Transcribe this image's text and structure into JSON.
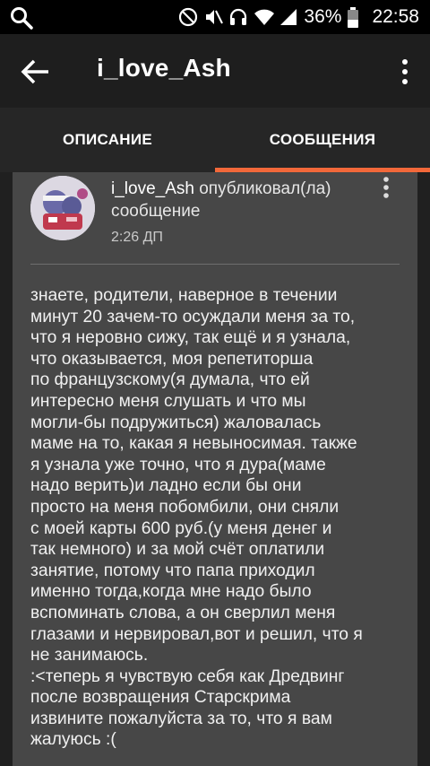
{
  "status_bar": {
    "battery_percent": "36%",
    "time": "22:58"
  },
  "app_bar": {
    "title": "i_love_Ash"
  },
  "tabs": [
    {
      "label": "ОПИСАНИЕ",
      "active": false
    },
    {
      "label": "СООБЩЕНИЯ",
      "active": true
    }
  ],
  "post": {
    "author": "i_love_Ash",
    "action": " опубликовал(ла) сообщение",
    "time": "2:26 ДП",
    "body": "знаете, родители, наверное в течении\nминут 20 зачем-то осуждали меня за то,\nчто я неровно сижу, так ещё и я узнала,\nчто оказывается, моя репетиторша\nпо французскому(я думала, что ей\nинтересно меня слушать и что мы\nмогли-бы подружиться) жаловалась\nмаме на то, какая я невыносимая. также\nя узнала уже точно, что я дура(маме\nнадо верить)и ладно если бы они\nпросто на меня побомбили, они сняли\nс моей карты 600 руб.(у меня денег и\nтак немного) и за мой счёт оплатили\nзанятие, потому что папа приходил\nименно тогда,когда мне надо было\nвспоминать слова, а он сверлил меня\nглазами и нервировал,вот и решил, что я\nне занимаюсь.\n:<теперь я чувствую себя как Дредвинг\nпосле возвращения Старскрима\nизвините пожалуйста за то, что я вам\nжалуюсь :("
  },
  "colors": {
    "accent": "#f2683a",
    "card": "#474747",
    "tabs_bg": "#262626"
  }
}
